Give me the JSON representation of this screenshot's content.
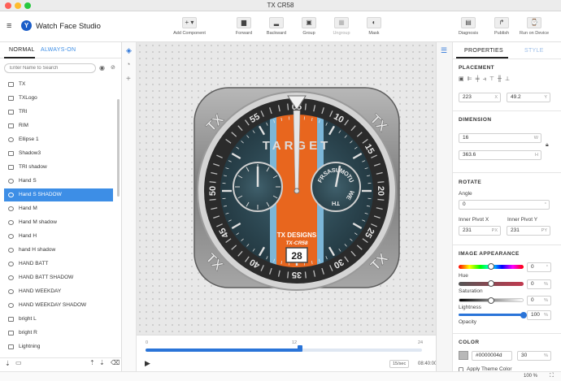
{
  "window": {
    "title": "TX CR58"
  },
  "app": {
    "name": "Watch Face Studio"
  },
  "toolbar": {
    "add_component": "Add Component",
    "forward": "Forward",
    "backward": "Backward",
    "group": "Group",
    "ungroup": "Ungroup",
    "mask": "Mask",
    "diagnosis": "Diagnosis",
    "publish": "Publish",
    "run_on_device": "Run on Device"
  },
  "layers_panel": {
    "tab_normal": "NORMAL",
    "tab_always_on": "ALWAYS-ON",
    "search_placeholder": "Enter Name to Search",
    "items": [
      {
        "label": "TX",
        "icon": "image-icon"
      },
      {
        "label": "TXLogo",
        "icon": "image-icon"
      },
      {
        "label": "TRI",
        "icon": "image-icon"
      },
      {
        "label": "RIM",
        "icon": "image-icon"
      },
      {
        "label": "Ellipse 1",
        "icon": "ellipse-icon"
      },
      {
        "label": "Shadow3",
        "icon": "image-icon"
      },
      {
        "label": "TRI shadow",
        "icon": "image-icon"
      },
      {
        "label": "Hand S",
        "icon": "clock-icon"
      },
      {
        "label": "Hand S SHADOW",
        "icon": "clock-icon",
        "selected": true
      },
      {
        "label": "Hand M",
        "icon": "clock-icon"
      },
      {
        "label": "Hand M shadow",
        "icon": "clock-icon"
      },
      {
        "label": "Hand H",
        "icon": "clock-icon"
      },
      {
        "label": "hand H shadow",
        "icon": "clock-icon"
      },
      {
        "label": "HAND BATT",
        "icon": "clock-icon"
      },
      {
        "label": "HAND BATT SHADOW",
        "icon": "clock-icon"
      },
      {
        "label": "HAND WEEKDAY",
        "icon": "clock-icon"
      },
      {
        "label": "HAND WEEKDAY SHADOW",
        "icon": "clock-icon"
      },
      {
        "label": "bright L",
        "icon": "image-icon"
      },
      {
        "label": "bright R",
        "icon": "image-icon"
      },
      {
        "label": "Lightning",
        "icon": "image-icon"
      }
    ]
  },
  "watch": {
    "corner_text": "TX",
    "bezel_numbers": [
      "55",
      "05",
      "10",
      "15",
      "20",
      "25",
      "30",
      "35",
      "40",
      "45",
      "50"
    ],
    "brand": "TARGET",
    "subtitle1": "TX DESIGNS",
    "subtitle2": "TX-CR58",
    "date": "28",
    "weekdays": [
      "FR",
      "SA",
      "SU",
      "MO",
      "TU",
      "WE",
      "TH"
    ],
    "colors": {
      "dial": "#33505c",
      "stripe_orange": "#e8661e",
      "stripe_blue": "#7cb6d8",
      "bezel": "#2b2b2b",
      "case": "#8e8e8e"
    }
  },
  "timeline": {
    "marks": [
      "0",
      "12",
      "24"
    ],
    "progress": 0.56,
    "speed": "15/sec",
    "time": "08:40:00"
  },
  "properties_panel": {
    "tab_properties": "PROPERTIES",
    "tab_style": "STYLE",
    "placement": {
      "title": "PLACEMENT",
      "x": "223",
      "x_unit": "X",
      "y": "49.2",
      "y_unit": "Y"
    },
    "dimension": {
      "title": "DIMENSION",
      "w": "16",
      "w_unit": "W",
      "h": "363.6",
      "h_unit": "H"
    },
    "rotate": {
      "title": "ROTATE",
      "angle_label": "Angle",
      "angle": "0",
      "angle_unit": "°",
      "pivot_x_label": "Inner Pivot X",
      "pivot_x": "231",
      "pivot_x_unit": "PX",
      "pivot_y_label": "Inner Pivot Y",
      "pivot_y": "231",
      "pivot_y_unit": "PY"
    },
    "image_appearance": {
      "title": "IMAGE APPEARANCE",
      "hue_label": "Hue",
      "hue_value": "0",
      "hue_unit": "°",
      "hue_level": 0.5,
      "saturation_label": "Saturation",
      "saturation_value": "0",
      "saturation_unit": "%",
      "saturation_level": 0.5,
      "lightness_label": "Lightness",
      "lightness_value": "0",
      "lightness_unit": "%",
      "lightness_level": 0.5,
      "opacity_label": "Opacity",
      "opacity_value": "100",
      "opacity_unit": "%",
      "opacity_level": 1.0
    },
    "color": {
      "title": "COLOR",
      "hex": "#0000004d",
      "alpha": "30",
      "alpha_unit": "%",
      "apply_theme": "Apply Theme Color"
    }
  },
  "status": {
    "zoom": "100 %"
  }
}
